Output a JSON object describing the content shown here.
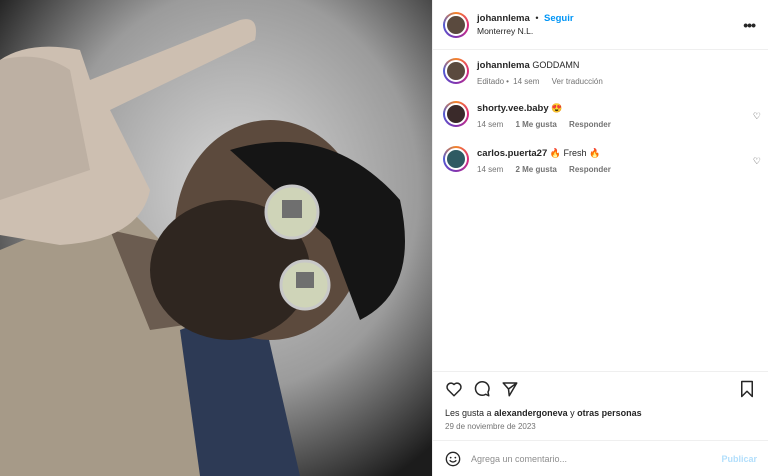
{
  "post": {
    "author": "johannlema",
    "follow_label": "Seguir",
    "separator": "•",
    "location": "Monterrey N.L.",
    "more_label": "•••",
    "caption": {
      "user": "johannlema",
      "text": "GODDAMN",
      "edited": "Editado",
      "time": "14 sem",
      "translate": "Ver traducción"
    },
    "comments": [
      {
        "user": "shorty.vee.baby",
        "text": "😍",
        "time": "14 sem",
        "likes": "1 Me gusta",
        "reply": "Responder"
      },
      {
        "user": "carlos.puerta27",
        "text": "🔥 Fresh 🔥",
        "time": "14 sem",
        "likes": "2 Me gusta",
        "reply": "Responder"
      }
    ],
    "liked_by_prefix": "Les gusta a",
    "liked_by_user": "alexandergoneva",
    "liked_by_suffix": "y",
    "liked_by_others": "otras personas",
    "date": "29 de noviembre de 2023",
    "add_comment_placeholder": "Agrega un comentario...",
    "publish_label": "Publicar"
  },
  "icons": {
    "more": "more-icon",
    "like": "heart-icon",
    "comment": "comment-icon",
    "share": "share-icon",
    "save": "bookmark-icon",
    "emoji": "emoji-icon"
  },
  "colors": {
    "follow": "#0095f6",
    "publish_disabled": "#b2dffc",
    "muted": "#737373"
  }
}
